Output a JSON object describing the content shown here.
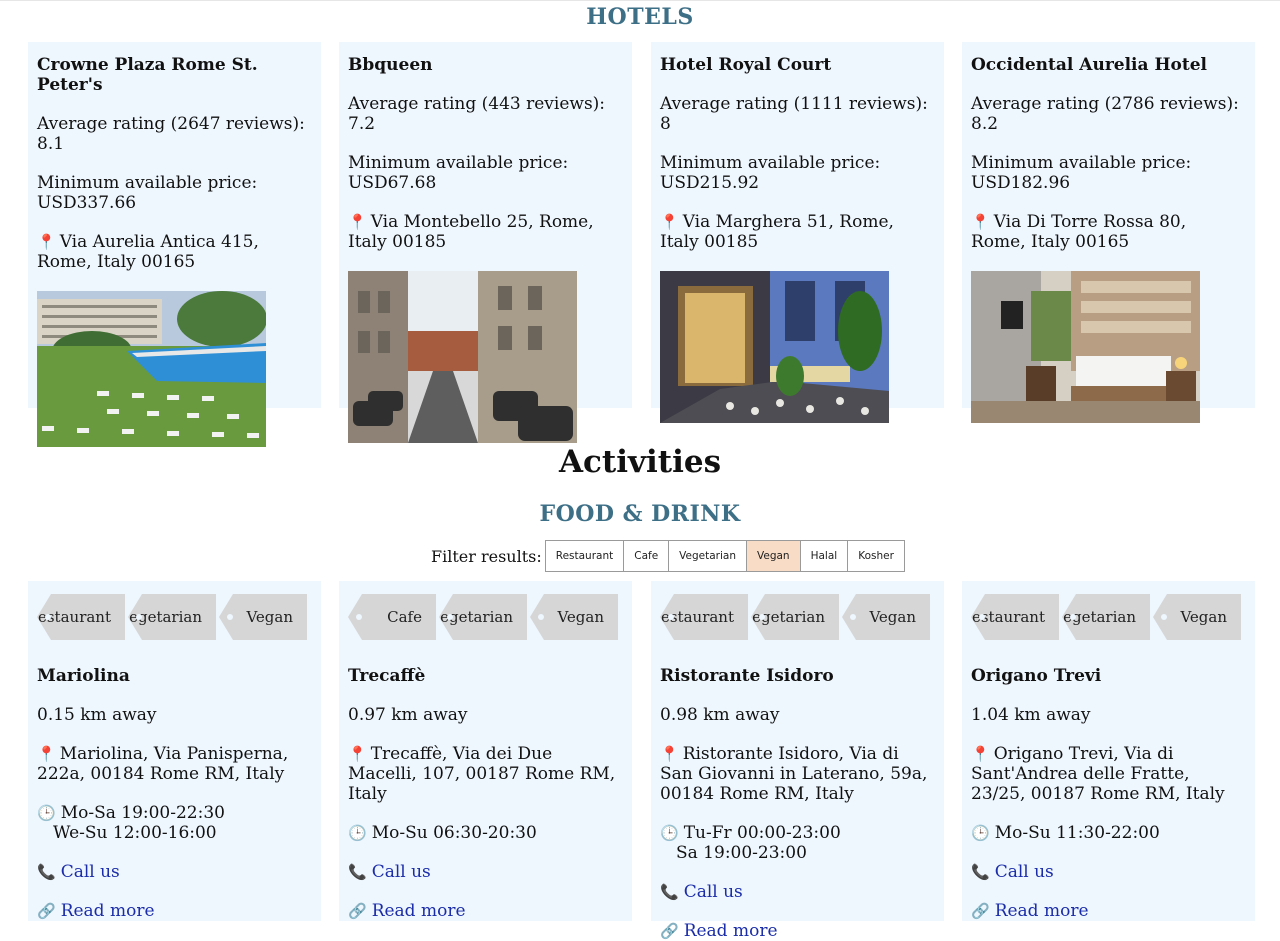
{
  "hotels": {
    "heading": "HOTELS",
    "items": [
      {
        "name": "Crowne Plaza Rome St. Peter's",
        "rating": "Average rating (2647 reviews): 8.1",
        "price": "Minimum available price: USD337.66",
        "address": "Via Aurelia Antica 415, Rome, Italy 00165"
      },
      {
        "name": "Bbqueen",
        "rating": "Average rating (443 reviews): 7.2",
        "price": "Minimum available price: USD67.68",
        "address": "Via Montebello 25, Rome, Italy 00185"
      },
      {
        "name": "Hotel Royal Court",
        "rating": "Average rating (1111 reviews): 8",
        "price": "Minimum available price: USD215.92",
        "address": "Via Marghera 51, Rome, Italy 00185"
      },
      {
        "name": "Occidental Aurelia Hotel",
        "rating": "Average rating (2786 reviews): 8.2",
        "price": "Minimum available price: USD182.96",
        "address": "Via Di Torre Rossa 80, Rome, Italy 00165"
      }
    ]
  },
  "activities": {
    "heading": "Activities",
    "food_heading": "FOOD & DRINK",
    "filter_label": "Filter results:",
    "filters": [
      "Restaurant",
      "Cafe",
      "Vegetarian",
      "Vegan",
      "Halal",
      "Kosher"
    ],
    "active_filter": "Vegan",
    "places": [
      {
        "tags": [
          "Restaurant",
          "Vegetarian",
          "Vegan"
        ],
        "name": "Mariolina",
        "distance": "0.15 km away",
        "address": "Mariolina, Via Panisperna, 222a, 00184 Rome RM, Italy",
        "hours": [
          "Mo-Sa 19:00-22:30",
          "We-Su 12:00-16:00"
        ],
        "call": "Call us",
        "more": "Read more"
      },
      {
        "tags": [
          "Cafe",
          "Vegetarian",
          "Vegan"
        ],
        "name": "Trecaffè",
        "distance": "0.97 km away",
        "address": "Trecaffè, Via dei Due Macelli, 107, 00187 Rome RM, Italy",
        "hours": [
          "Mo-Su 06:30-20:30"
        ],
        "call": "Call us",
        "more": "Read more"
      },
      {
        "tags": [
          "Restaurant",
          "Vegetarian",
          "Vegan"
        ],
        "name": "Ristorante Isidoro",
        "distance": "0.98 km away",
        "address": "Ristorante Isidoro, Via di San Giovanni in Laterano, 59a, 00184 Rome RM, Italy",
        "hours": [
          "Tu-Fr 00:00-23:00",
          "Sa 19:00-23:00"
        ],
        "call": "Call us",
        "more": "Read more"
      },
      {
        "tags": [
          "Restaurant",
          "Vegetarian",
          "Vegan"
        ],
        "name": "Origano Trevi",
        "distance": "1.04 km away",
        "address": "Origano Trevi, Via di Sant'Andrea delle Fratte, 23/25, 00187 Rome RM, Italy",
        "hours": [
          "Mo-Su 11:30-22:00"
        ],
        "call": "Call us",
        "more": "Read more"
      }
    ]
  },
  "icons": {
    "pin": "map-pin-icon",
    "clock": "clock-icon",
    "phone": "phone-icon",
    "link": "link-icon"
  }
}
